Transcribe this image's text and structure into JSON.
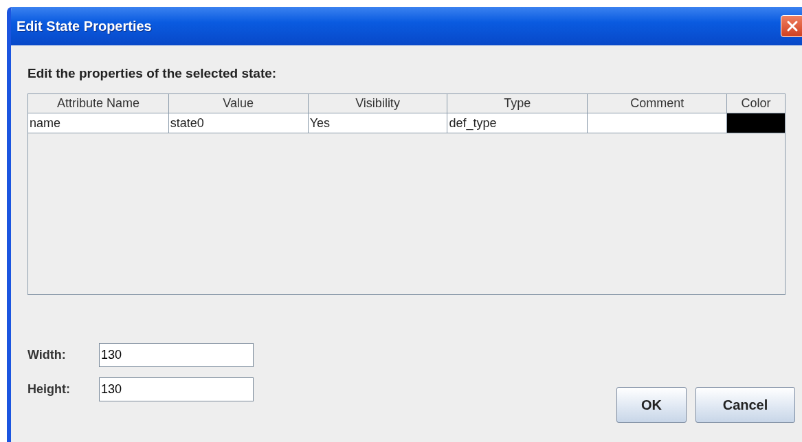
{
  "window": {
    "title": "Edit State Properties"
  },
  "prompt": "Edit the properties of the selected state:",
  "table": {
    "columns": [
      "Attribute Name",
      "Value",
      "Visibility",
      "Type",
      "Comment",
      "Color"
    ],
    "rows": [
      {
        "attribute_name": "name",
        "value": "state0",
        "visibility": "Yes",
        "type": "def_type",
        "color": "#000000"
      }
    ]
  },
  "fields": [
    {
      "label": "Width:",
      "value": "130"
    },
    {
      "label": "Height:",
      "value": "130"
    }
  ],
  "buttons": [
    "OK",
    "Cancel"
  ]
}
